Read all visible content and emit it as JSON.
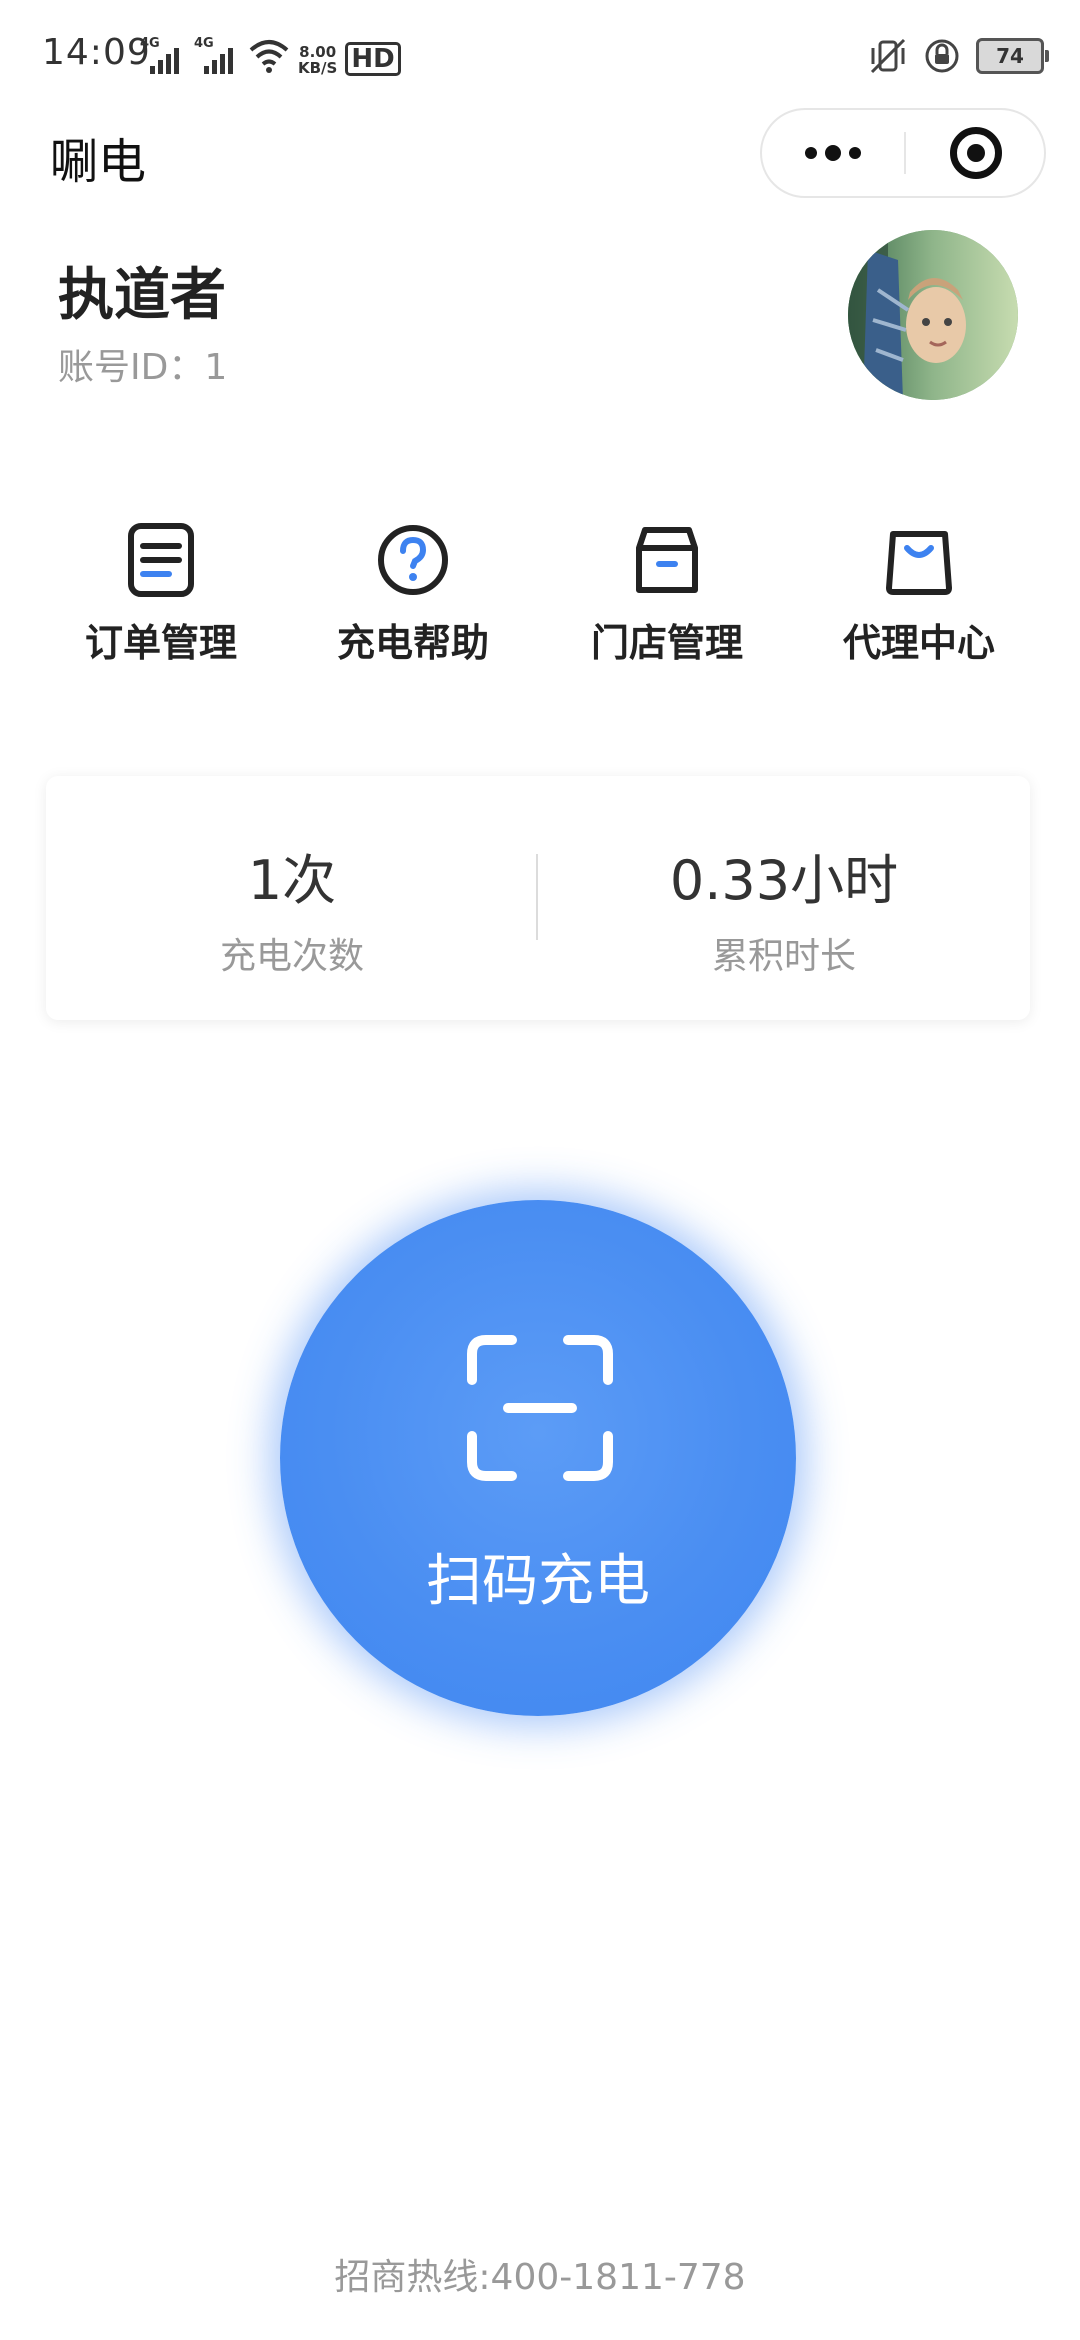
{
  "status_bar": {
    "time": "14:09",
    "network_1": "4G",
    "network_2": "4G",
    "speed_value": "8.00",
    "speed_unit": "KB/S",
    "hd_badge": "HD",
    "battery": "74",
    "icons": [
      "signal-icon",
      "signal-icon",
      "wifi-icon",
      "vibrate-icon",
      "rotation-lock-icon",
      "battery-icon"
    ]
  },
  "title_bar": {
    "title": "唰电",
    "capsule": {
      "more_icon": "more-dots-icon",
      "close_icon": "target-circle-icon"
    }
  },
  "profile": {
    "name": "执道者",
    "account_id": "账号ID：1",
    "avatar": "avatar"
  },
  "menu": {
    "items": [
      {
        "label": "订单管理",
        "icon": "order-list-icon"
      },
      {
        "label": "充电帮助",
        "icon": "help-question-icon"
      },
      {
        "label": "门店管理",
        "icon": "store-box-icon"
      },
      {
        "label": "代理中心",
        "icon": "shopping-bag-icon"
      }
    ]
  },
  "stats": {
    "charge_count_value": "1次",
    "charge_count_label": "充电次数",
    "duration_value": "0.33小时",
    "duration_label": "累积时长"
  },
  "scan": {
    "label": "扫码充电",
    "icon": "scan-frame-icon"
  },
  "footer": {
    "hotline": "招商热线:400-1811-778"
  },
  "colors": {
    "accent": "#4a8ef2",
    "icon_dark": "#222222",
    "icon_blue": "#3d82f0",
    "muted_text": "#999999"
  }
}
